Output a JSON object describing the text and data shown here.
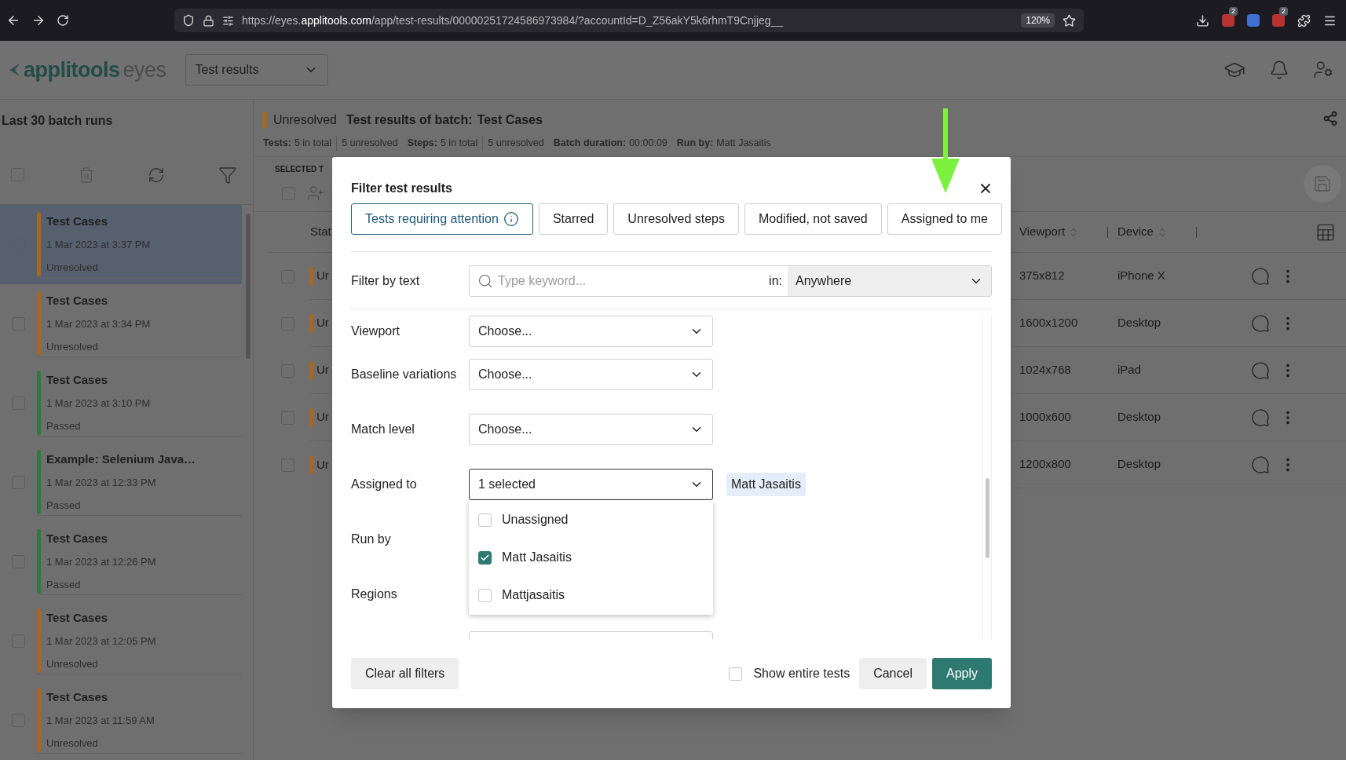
{
  "browser": {
    "url": "https://eyes.**applitools.com**/app/test-results/00000251724586973984/?accountId=D_Z56akY5k6rhmT9Cnjjeg__",
    "zoom": "120%",
    "extensions": [
      {
        "color": "#b8332e",
        "badge": "2"
      },
      {
        "color": "#3f6fd0"
      },
      {
        "color": "#b8332e",
        "badge": "2"
      }
    ]
  },
  "header": {
    "logo_main": "applitools",
    "logo_sub": "eyes",
    "view_select": "Test results"
  },
  "sidebar": {
    "title": "Last 30 batch runs",
    "select_all_checked": false,
    "batches": [
      {
        "name": "Test Cases",
        "date": "1 Mar 2023 at 3:37 PM",
        "status": "Unresolved",
        "color": "#a8671d",
        "selected": true,
        "checked": false
      },
      {
        "name": "Test Cases",
        "date": "1 Mar 2023 at 3:34 PM",
        "status": "Unresolved",
        "color": "#a8671d",
        "selected": false,
        "checked": false
      },
      {
        "name": "Test Cases",
        "date": "1 Mar 2023 at 3:10 PM",
        "status": "Passed",
        "color": "#2f7a3a",
        "selected": false,
        "checked": false
      },
      {
        "name": "Example: Selenium Java…",
        "date": "1 Mar 2023 at 12:33 PM",
        "status": "Passed",
        "color": "#2f7a3a",
        "selected": false,
        "checked": false
      },
      {
        "name": "Test Cases",
        "date": "1 Mar 2023 at 12:26 PM",
        "status": "Passed",
        "color": "#2f7a3a",
        "selected": false,
        "checked": false
      },
      {
        "name": "Test Cases",
        "date": "1 Mar 2023 at 12:05 PM",
        "status": "Unresolved",
        "color": "#a8671d",
        "selected": false,
        "checked": false
      },
      {
        "name": "Test Cases",
        "date": "1 Mar 2023 at 11:59 AM",
        "status": "Unresolved",
        "color": "#a8671d",
        "selected": false,
        "checked": false
      }
    ]
  },
  "batch": {
    "status": "Unresolved",
    "color": "#a8671d",
    "title_label": "Test results of batch:",
    "title": "Test Cases",
    "stats": [
      {
        "label": "Tests:",
        "values": [
          "5 in total",
          "5 unresolved"
        ]
      },
      {
        "label": "Steps:",
        "values": [
          "5 in total",
          "5 unresolved"
        ]
      },
      {
        "label": "Batch duration:",
        "values": [
          "00:00:09"
        ]
      },
      {
        "label": "Run by:",
        "values": [
          "Matt Jasaitis"
        ]
      }
    ],
    "selected_label": "SELECTED T",
    "select_all_checked": false
  },
  "table": {
    "column_left": "Stat",
    "columns_right": [
      "Viewport",
      "Device"
    ],
    "rows": [
      {
        "status": "Ur",
        "color": "#a8671d",
        "viewport": "375x812",
        "device": "iPhone X",
        "checked": false
      },
      {
        "status": "Ur",
        "color": "#a8671d",
        "viewport": "1600x1200",
        "device": "Desktop",
        "checked": false
      },
      {
        "status": "Ur",
        "color": "#a8671d",
        "viewport": "1024x768",
        "device": "iPad",
        "checked": false
      },
      {
        "status": "Ur",
        "color": "#a8671d",
        "viewport": "1000x600",
        "device": "Desktop",
        "checked": false
      },
      {
        "status": "Ur",
        "color": "#a8671d",
        "viewport": "1200x800",
        "device": "Desktop",
        "checked": false
      }
    ]
  },
  "dialog": {
    "title": "Filter test results",
    "quick_filters": [
      {
        "label": "Tests requiring attention",
        "info": true,
        "selected": true
      },
      {
        "label": "Starred",
        "info": false,
        "selected": false
      },
      {
        "label": "Unresolved steps",
        "info": false,
        "selected": false
      },
      {
        "label": "Modified, not saved",
        "info": false,
        "selected": false
      },
      {
        "label": "Assigned to me",
        "info": false,
        "selected": false
      }
    ],
    "text_filter": {
      "label": "Filter by text",
      "placeholder": "Type keyword...",
      "in_label": "in:",
      "scope": "Anywhere"
    },
    "fields": [
      {
        "kind": "select",
        "label": "Viewport",
        "value": "Choose...",
        "focused": false
      },
      {
        "kind": "select",
        "label": "Baseline variations",
        "value": "Choose...",
        "focused": false
      },
      {
        "kind": "select",
        "label": "Match level",
        "value": "Choose...",
        "focused": false
      },
      {
        "kind": "select",
        "label": "Assigned to",
        "value": "1 selected",
        "focused": true,
        "tags": [
          "Matt Jasaitis"
        ],
        "options": [
          {
            "label": "Unassigned",
            "checked": false
          },
          {
            "label": "Matt Jasaitis",
            "checked": true
          },
          {
            "label": "Mattjasaitis",
            "checked": false
          }
        ]
      },
      {
        "kind": "label_only",
        "label": "Run by"
      },
      {
        "kind": "label_only",
        "label": "Regions"
      },
      {
        "kind": "cut"
      }
    ],
    "footer": {
      "clear": "Clear all filters",
      "show_entire": {
        "label": "Show entire tests",
        "checked": false
      },
      "cancel": "Cancel",
      "apply": "Apply"
    }
  }
}
